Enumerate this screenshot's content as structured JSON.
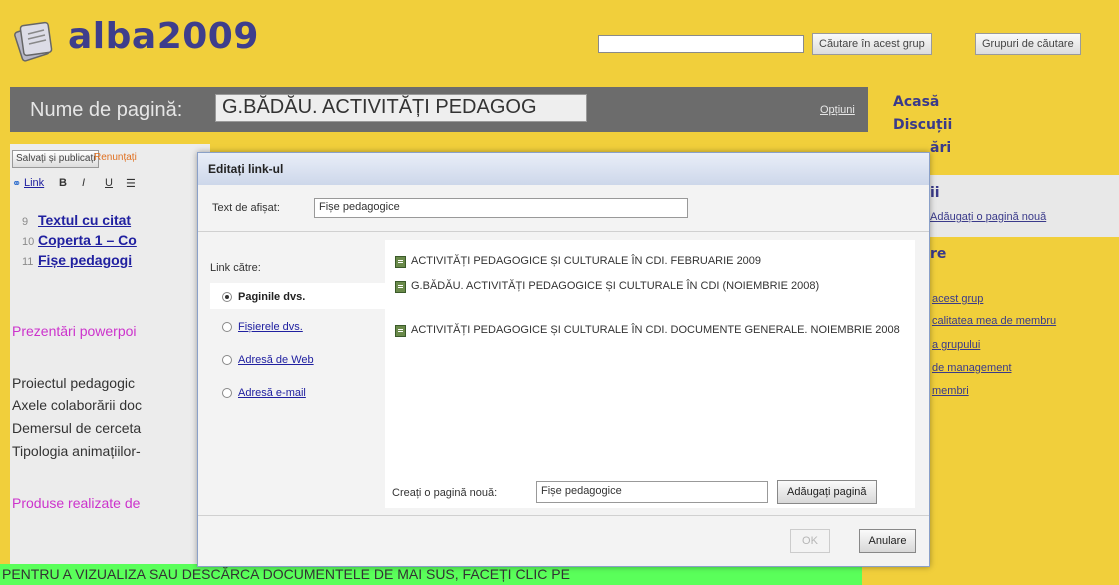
{
  "header": {
    "site_title": "alba2009",
    "search_placeholder": "",
    "search_group_label": "Căutare în acest grup",
    "search_groups_label": "Grupuri de căutare"
  },
  "page_name_bar": {
    "label": "Nume de pagină:",
    "value": "G.BĂDĂU. ACTIVITĂȚI PEDAGOG",
    "options": "Opțiuni"
  },
  "editor": {
    "save_label": "Salvați și publicați",
    "discard_label": "Renunțați",
    "toolbar": [
      "Link",
      "B",
      "I",
      "U",
      "☰"
    ],
    "list_items": [
      {
        "num": "9",
        "text": "Textul cu citat"
      },
      {
        "num": "10",
        "text": "Coperta 1 – Co"
      },
      {
        "num": "11",
        "text": "Fișe pedagogi"
      }
    ],
    "powerpoint": "Prezentări powerpoi",
    "dark_lines": [
      "Proiectul pedagogic",
      "Axele colaborării doc",
      "Demersul de cerceta",
      "Tipologia animațiilor-"
    ],
    "products": "Produse realizate de",
    "green_banner": "PENTRU A VIZUALIZA SAU DESCĂRCA DOCUMENTELE DE MAI SUS, FACEȚI CLIC PE"
  },
  "sidebar": {
    "home": "Acasă",
    "discussions": "Discuții",
    "pages_partial": "ări",
    "section_partial": "ii",
    "add_page": "Adăugați o pagină nouă",
    "section2_partial": "re",
    "links": [
      "acest grup",
      "calitatea mea de membru",
      "a grupului",
      "de management",
      "membri"
    ]
  },
  "modal": {
    "title": "Editați link-ul",
    "display_text_label": "Text de afișat:",
    "display_text_value": "Fișe pedagogice",
    "link_to_label": "Link către:",
    "nav": [
      {
        "label": "Paginile dvs.",
        "selected": true
      },
      {
        "label": "Fișierele dvs.",
        "selected": false
      },
      {
        "label": "Adresă de Web",
        "selected": false
      },
      {
        "label": "Adresă e-mail",
        "selected": false
      }
    ],
    "pages": [
      "ACTIVITĂȚI PEDAGOGICE ȘI CULTURALE ÎN CDI. FEBRUARIE 2009",
      "G.BĂDĂU. ACTIVITĂȚI PEDAGOGICE ȘI CULTURALE ÎN CDI (NOIEMBRIE 2008)",
      "ACTIVITĂȚI PEDAGOGICE ȘI CULTURALE ÎN CDI. DOCUMENTE GENERALE. NOIEMBRIE 2008"
    ],
    "new_page_label": "Creați o pagină nouă:",
    "new_page_value": "Fișe pedagogice",
    "add_page_button": "Adăugați pagină",
    "ok_button": "OK",
    "cancel_button": "Anulare"
  },
  "colors": {
    "background": "#f1cf3b",
    "title": "#3e3e8c",
    "banner": "#5aff5a"
  }
}
